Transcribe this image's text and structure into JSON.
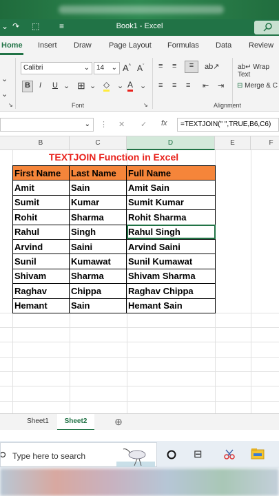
{
  "titlebar": {
    "title": "Book1 - Excel"
  },
  "tabs": [
    "Home",
    "Insert",
    "Draw",
    "Page Layout",
    "Formulas",
    "Data",
    "Review"
  ],
  "ribbon": {
    "font_name": "Calibri",
    "font_size": "14",
    "font_group_label": "Font",
    "alignment_group_label": "Alignment",
    "wrap_text_label": "Wrap Text",
    "merge_label": "Merge & C"
  },
  "formula_bar": {
    "formula": "=TEXTJOIN(\" \",TRUE,B6,C6)"
  },
  "columns": [
    "B",
    "C",
    "D",
    "E",
    "F"
  ],
  "sheet": {
    "heading": "TEXTJOIN Function in Excel",
    "headers": [
      "First Name",
      "Last Name",
      "Full Name"
    ],
    "rows": [
      [
        "Amit",
        "Sain",
        "Amit Sain"
      ],
      [
        "Sumit",
        "Kumar",
        "Sumit Kumar"
      ],
      [
        "Rohit",
        "Sharma",
        "Rohit Sharma"
      ],
      [
        "Rahul",
        "Singh",
        "Rahul Singh"
      ],
      [
        "Arvind",
        "Saini",
        "Arvind Saini"
      ],
      [
        "Sunil",
        "Kumawat",
        "Sunil Kumawat"
      ],
      [
        "Shivam",
        "Sharma",
        "Shivam Sharma"
      ],
      [
        "Raghav",
        "Chippa",
        "Raghav Chippa"
      ],
      [
        "Hemant",
        "Sain",
        "Hemant Sain"
      ]
    ]
  },
  "sheet_tabs": [
    "Sheet1",
    "Sheet2"
  ],
  "taskbar": {
    "search_placeholder": "Type here to search"
  },
  "colors": {
    "excel_green": "#217346",
    "header_fill": "#f5853a",
    "heading_red": "#e8211b"
  }
}
